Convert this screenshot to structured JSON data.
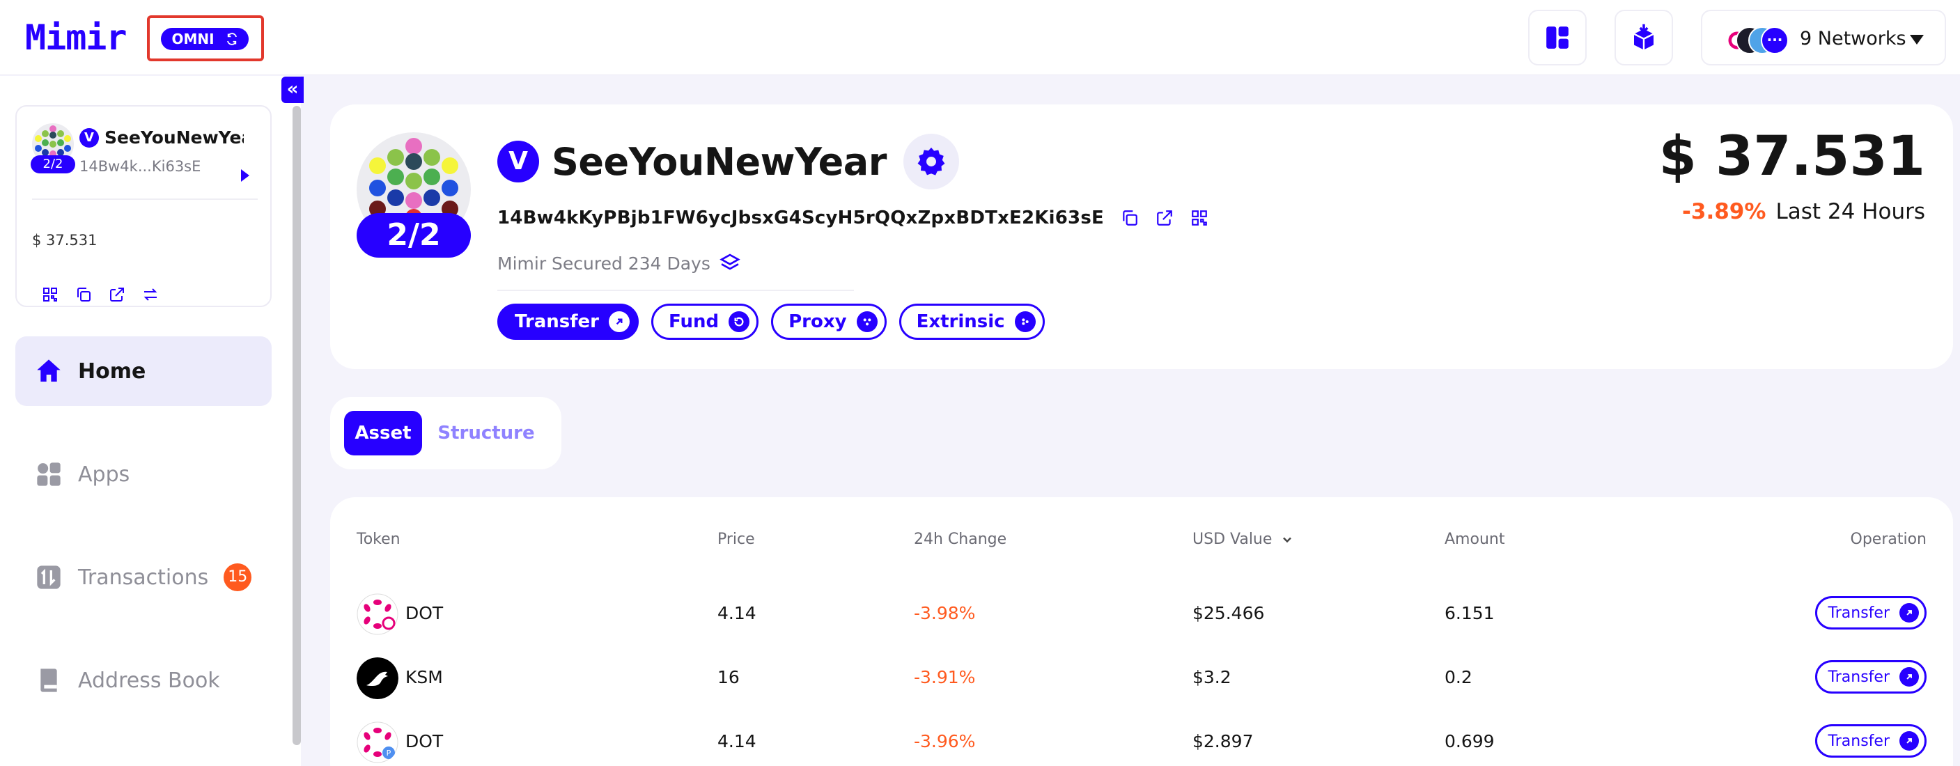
{
  "header": {
    "logo": "Mimir",
    "omni_label": "OMNI",
    "networks_label": "9 Networks"
  },
  "sidebar": {
    "account": {
      "name": "SeeYouNewYear",
      "address_short": "14Bw4k...Ki63sE",
      "threshold": "2/2",
      "verified_mark": "V",
      "balance": "$ 37.531"
    },
    "nav": [
      {
        "label": "Home",
        "icon": "home-icon",
        "active": true
      },
      {
        "label": "Apps",
        "icon": "apps-icon",
        "active": false
      },
      {
        "label": "Transactions",
        "icon": "transactions-icon",
        "active": false,
        "badge": "15"
      },
      {
        "label": "Address Book",
        "icon": "address-book-icon",
        "active": false
      }
    ]
  },
  "profile": {
    "name": "SeeYouNewYear",
    "verified_mark": "V",
    "threshold": "2/2",
    "address": "14Bw4kKyPBjb1FW6ycJbsxG4ScyH5rQQxZpxBDTxE2Ki63sE",
    "secured_text": "Mimir Secured 234 Days",
    "balance": "$ 37.531",
    "change_pct": "-3.89%",
    "change_period": "Last 24 Hours",
    "actions": [
      "Transfer",
      "Fund",
      "Proxy",
      "Extrinsic"
    ]
  },
  "tabs": [
    "Asset",
    "Structure"
  ],
  "table": {
    "headers": {
      "token": "Token",
      "price": "Price",
      "change": "24h Change",
      "usd": "USD Value",
      "amount": "Amount",
      "operation": "Operation"
    },
    "rows": [
      {
        "token": "DOT",
        "price": "4.14",
        "change": "-3.98%",
        "usd": "$25.466",
        "amount": "6.151",
        "action": "Transfer"
      },
      {
        "token": "KSM",
        "price": "16",
        "change": "-3.91%",
        "usd": "$3.2",
        "amount": "0.2",
        "action": "Transfer"
      },
      {
        "token": "DOT",
        "price": "4.14",
        "change": "-3.96%",
        "usd": "$2.897",
        "amount": "0.699",
        "action": "Transfer"
      }
    ]
  },
  "colors": {
    "brand": "#2700ff",
    "negative": "#ff5a1f",
    "highlight_box": "#e2382c"
  }
}
